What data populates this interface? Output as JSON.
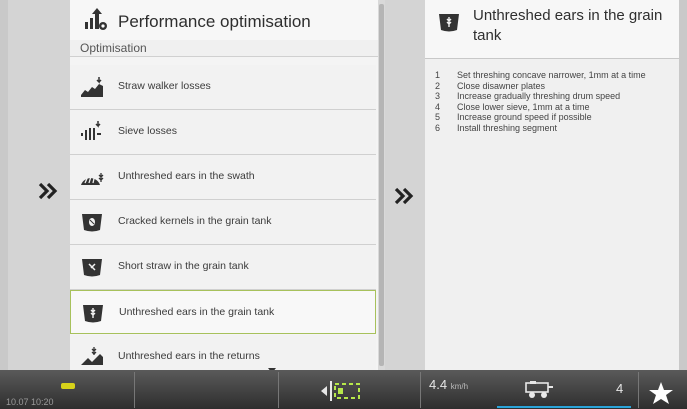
{
  "left_panel": {
    "title": "Performance optimisation",
    "section": "Optimisation",
    "items": [
      {
        "label": "Straw walker losses",
        "icon": "straw-walker-losses-icon"
      },
      {
        "label": "Sieve losses",
        "icon": "sieve-losses-icon"
      },
      {
        "label": "Unthreshed ears in the swath",
        "icon": "swath-ears-icon"
      },
      {
        "label": "Cracked kernels in the grain tank",
        "icon": "cracked-kernels-icon"
      },
      {
        "label": "Short straw in the grain tank",
        "icon": "short-straw-icon"
      },
      {
        "label": "Unthreshed ears in the grain tank",
        "icon": "grain-tank-ears-icon",
        "selected": true
      },
      {
        "label": "Unthreshed ears in the returns",
        "icon": "returns-ears-icon"
      }
    ]
  },
  "right_panel": {
    "title": "Unthreshed ears in the grain tank",
    "steps": [
      {
        "n": "1",
        "text": "Set threshing concave narrower, 1mm at a time"
      },
      {
        "n": "2",
        "text": "Close disawner plates"
      },
      {
        "n": "3",
        "text": "Increase gradually threshing drum speed"
      },
      {
        "n": "4",
        "text": "Close lower sieve, 1mm at a time"
      },
      {
        "n": "5",
        "text": "Increase ground speed if possible"
      },
      {
        "n": "6",
        "text": "Install threshing segment"
      }
    ]
  },
  "status_bar": {
    "clock": "10.07 10:20",
    "speed_value": "4.4",
    "speed_unit": "km/h",
    "count": "4"
  },
  "colors": {
    "selected_border": "#a7c15b",
    "speed_bar": "#2aa3d8",
    "badge_yellow": "#d7d21a"
  }
}
